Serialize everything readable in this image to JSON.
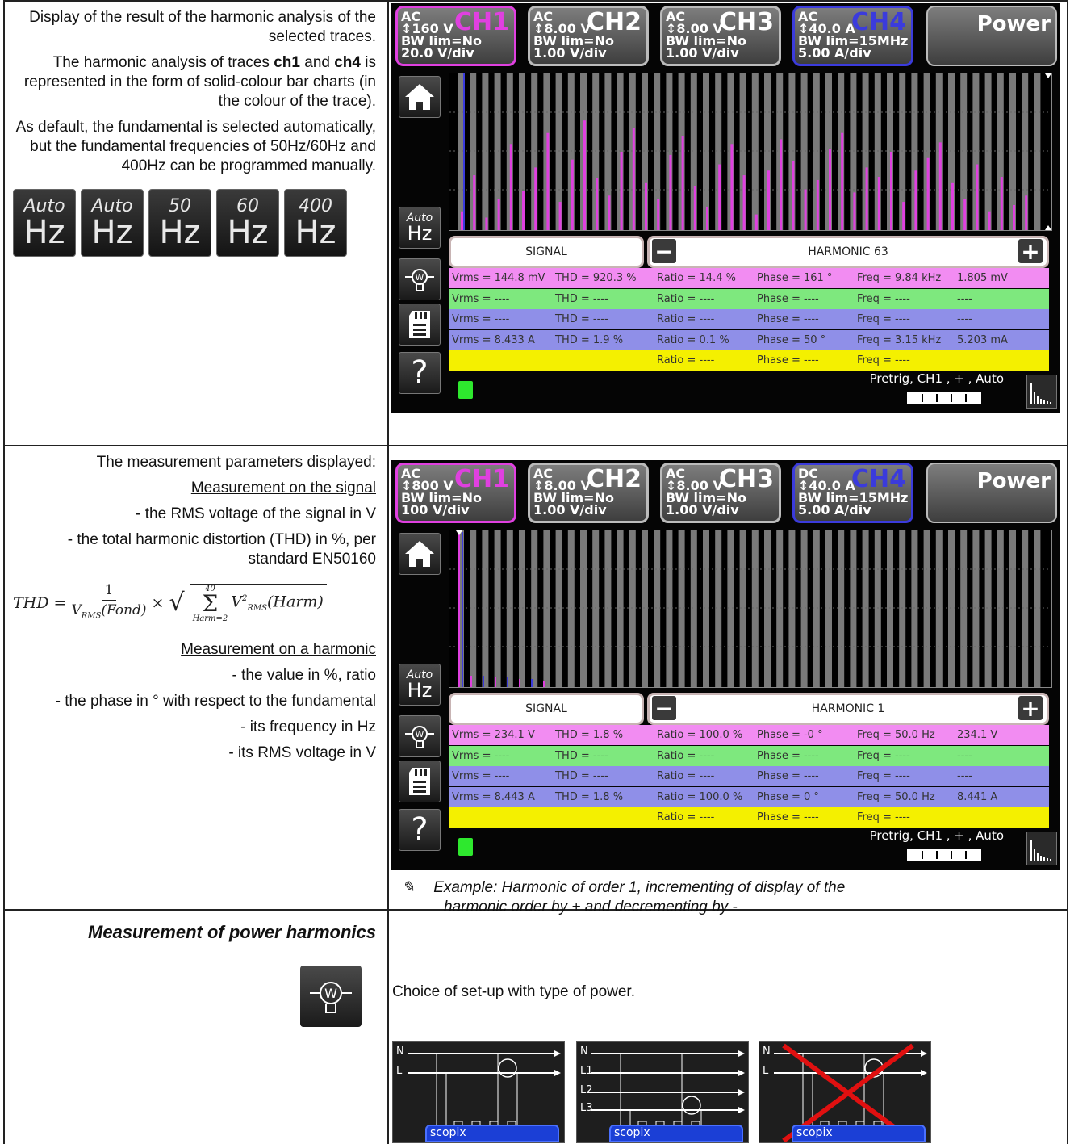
{
  "row1": {
    "p1": "Display of the result of the harmonic analysis of the selected traces.",
    "p2_pre": "The harmonic analysis of traces",
    "p2_b1": "ch1",
    "p2_and": "and",
    "p2_b2": "ch4",
    "p2_post": "is represented in the form of solid-colour bar charts (in the colour of the trace).",
    "p3": "As default, the fundamental is selected automatically, but the fundamental frequencies of 50Hz/60Hz and 400Hz can be programmed manually.",
    "hz_buttons": [
      {
        "top": "Auto",
        "bot": "Hz"
      },
      {
        "top": "Auto",
        "bot": "Hz"
      },
      {
        "top": "50",
        "bot": "Hz"
      },
      {
        "top": "60",
        "bot": "Hz"
      },
      {
        "top": "400",
        "bot": "Hz"
      }
    ]
  },
  "screen1": {
    "ch1": {
      "coupling": "AC",
      "range": "↕160 V",
      "bw": "BW lim=No",
      "div": "20.0 V/div",
      "name": "CH1"
    },
    "ch2": {
      "coupling": "AC",
      "range": "↕8.00 V",
      "bw": "BW lim=No",
      "div": "1.00 V/div",
      "name": "CH2"
    },
    "ch3": {
      "coupling": "AC",
      "range": "↕8.00 V",
      "bw": "BW lim=No",
      "div": "1.00 V/div",
      "name": "CH3"
    },
    "ch4": {
      "coupling": "AC",
      "range": "↕40.0 A",
      "bw": "BW lim=15MHz",
      "div": "5.00 A/div",
      "name": "CH4"
    },
    "power": "Power",
    "signal_label": "SIGNAL",
    "harmonic_label": "HARMONIC 63",
    "rows": [
      {
        "c1": "Vrms = 144.8 mV",
        "c2": "THD = 920.3 %",
        "c3": "Ratio = 14.4 %",
        "c4": "Phase = 161 °",
        "c5": "Freq = 9.84 kHz",
        "c6": "1.805 mV"
      },
      {
        "c1": "Vrms = ----",
        "c2": "THD = ----",
        "c3": "Ratio = ----",
        "c4": "Phase = ----",
        "c5": "Freq = ----",
        "c6": "----"
      },
      {
        "c1": "Vrms = ----",
        "c2": "THD = ----",
        "c3": "Ratio = ----",
        "c4": "Phase = ----",
        "c5": "Freq = ----",
        "c6": "----"
      },
      {
        "c1": "Vrms = 8.433 A",
        "c2": "THD = 1.9 %",
        "c3": "Ratio = 0.1 %",
        "c4": "Phase = 50 °",
        "c5": "Freq = 3.15 kHz",
        "c6": "5.203 mA"
      },
      {
        "c1": "",
        "c2": "",
        "c3": "Ratio = ----",
        "c4": "Phase = ----",
        "c5": "Freq = ----",
        "c6": ""
      }
    ],
    "status": "Pretrig, CH1 , + , Auto",
    "bars_pink": [
      0.12,
      0.35,
      0.08,
      0.2,
      0.55,
      0.25,
      0.4,
      0.62,
      0.18,
      0.45,
      0.7,
      0.33,
      0.22,
      0.5,
      0.65,
      0.3,
      0.2,
      0.48,
      0.6,
      0.28,
      0.15,
      0.42,
      0.55,
      0.35,
      0.1,
      0.38,
      0.58,
      0.44,
      0.26,
      0.32,
      0.52,
      0.62,
      0.24,
      0.4,
      0.34,
      0.5,
      0.18,
      0.38,
      0.46,
      0.56,
      0.3,
      0.2,
      0.42,
      0.12,
      0.34,
      0.16,
      0.22
    ]
  },
  "row2": {
    "p1": "The measurement parameters displayed:",
    "u1": "Measurement on the signal",
    "l1": "- the RMS voltage of the signal in V",
    "l2": "- the total harmonic distortion (THD) in %, per standard EN50160",
    "formula_lhs": "THD =",
    "formula_num": "1",
    "formula_den": "V",
    "formula_den_sub": "RMS",
    "formula_den2": "(Fond)",
    "formula_times": "×",
    "formula_sum_top": "40",
    "formula_sum_bot": "Harm=2",
    "formula_v": "V",
    "formula_v_sup": "2",
    "formula_v_sub": "RMS",
    "formula_harm": "(Harm)",
    "u2": "Measurement on a harmonic",
    "h1": "- the value in %, ratio",
    "h2": "- the phase in ° with respect to the fundamental",
    "h3": "- its frequency in Hz",
    "h4": "- its RMS voltage in V"
  },
  "screen2": {
    "ch1": {
      "coupling": "AC",
      "range": "↕800 V",
      "bw": "BW lim=No",
      "div": "100 V/div",
      "name": "CH1"
    },
    "ch2": {
      "coupling": "AC",
      "range": "↕8.00 V",
      "bw": "BW lim=No",
      "div": "1.00 V/div",
      "name": "CH2"
    },
    "ch3": {
      "coupling": "AC",
      "range": "↕8.00 V",
      "bw": "BW lim=No",
      "div": "1.00 V/div",
      "name": "CH3"
    },
    "ch4": {
      "coupling": "DC",
      "range": "↕40.0 A",
      "bw": "BW lim=15MHz",
      "div": "5.00 A/div",
      "name": "CH4"
    },
    "power": "Power",
    "signal_label": "SIGNAL",
    "harmonic_label": "HARMONIC 1",
    "rows": [
      {
        "c1": "Vrms = 234.1 V",
        "c2": "THD = 1.8 %",
        "c3": "Ratio = 100.0 %",
        "c4": "Phase = -0 °",
        "c5": "Freq = 50.0 Hz",
        "c6": "234.1 V"
      },
      {
        "c1": "Vrms = ----",
        "c2": "THD = ----",
        "c3": "Ratio = ----",
        "c4": "Phase = ----",
        "c5": "Freq = ----",
        "c6": "----"
      },
      {
        "c1": "Vrms = ----",
        "c2": "THD = ----",
        "c3": "Ratio = ----",
        "c4": "Phase = ----",
        "c5": "Freq = ----",
        "c6": "----"
      },
      {
        "c1": "Vrms = 8.443 A",
        "c2": "THD = 1.8 %",
        "c3": "Ratio = 100.0 %",
        "c4": "Phase = 0 °",
        "c5": "Freq = 50.0 Hz",
        "c6": "8.441 A"
      },
      {
        "c1": "",
        "c2": "",
        "c3": "Ratio = ----",
        "c4": "Phase = ----",
        "c5": "Freq = ----",
        "c6": ""
      }
    ],
    "status": "Pretrig, CH1 , + , Auto",
    "note_symbol": "✎",
    "note_line1": "Example:   Harmonic of order 1, incrementing of display of the",
    "note_line2": "harmonic order by + and decrementing by -"
  },
  "row3": {
    "title": "Measurement of power harmonics",
    "choice": "Choice of set-up with type of power.",
    "diagrams": [
      {
        "lines": [
          "N",
          "L"
        ],
        "brand": "scopix"
      },
      {
        "lines": [
          "N",
          "L1",
          "L2",
          "L3"
        ],
        "brand": "scopix"
      },
      {
        "lines": [
          "N",
          "L"
        ],
        "brand": "scopix"
      }
    ]
  },
  "colors": {
    "ch1": "#e040e0",
    "ch4": "#3b3bdc",
    "row_pink": "#f28cf2",
    "row_green": "#7ee87e",
    "row_blue": "#8f8fe8",
    "row_yellow": "#f4f000"
  }
}
